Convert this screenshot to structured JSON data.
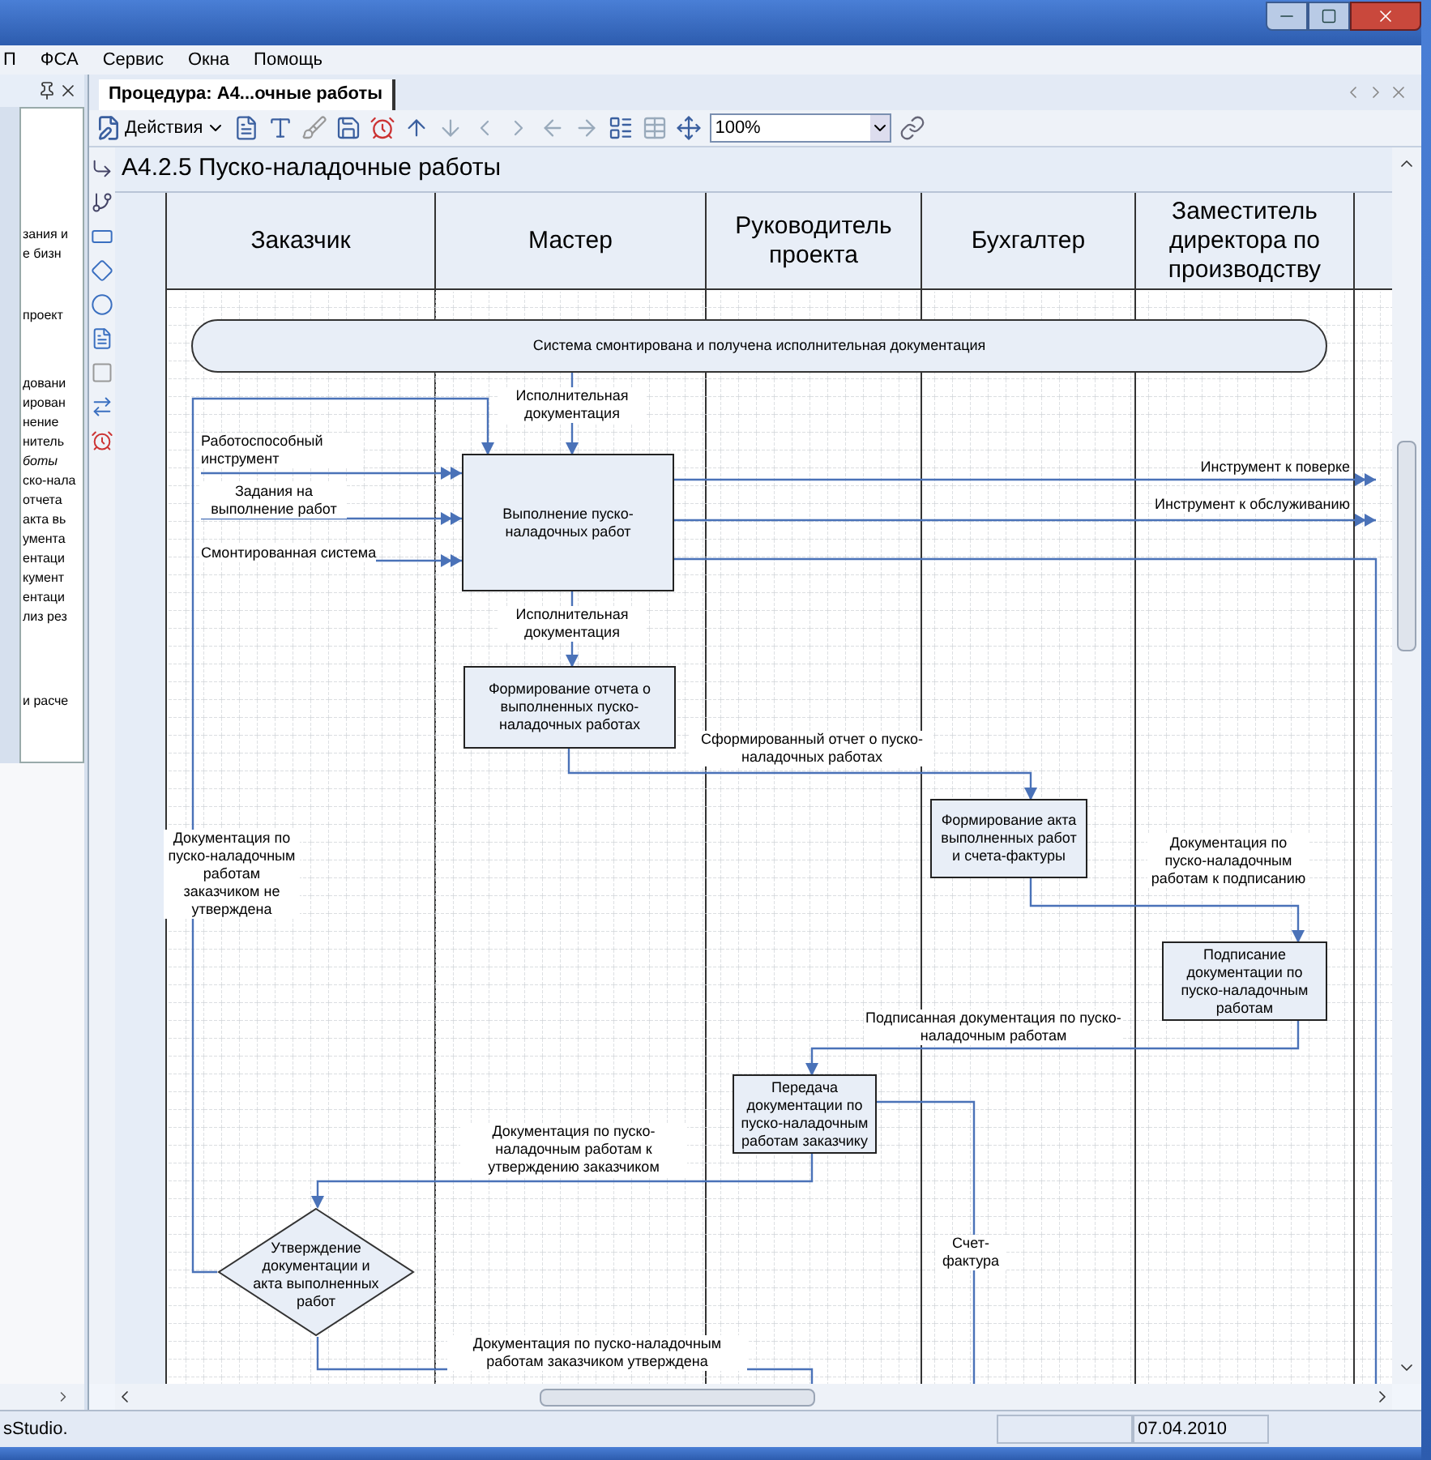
{
  "menu": [
    "П",
    "ФСА",
    "Сервис",
    "Окна",
    "Помощь"
  ],
  "left_panel": {
    "groups": [
      [
        {
          "text": "зания и",
          "italic": false
        },
        {
          "text": "е бизн",
          "italic": false
        }
      ],
      [
        {
          "text": "проект",
          "italic": false
        }
      ],
      [
        {
          "text": "довани",
          "italic": false
        },
        {
          "text": "ирован",
          "italic": false
        },
        {
          "text": "нение",
          "italic": false
        },
        {
          "text": "нитель",
          "italic": false
        },
        {
          "text": "боты",
          "italic": true
        },
        {
          "text": "ско-нала",
          "italic": false
        },
        {
          "text": "отчета",
          "italic": false
        },
        {
          "text": "акта вь",
          "italic": false
        },
        {
          "text": "умента",
          "italic": false
        },
        {
          "text": "ентаци",
          "italic": false
        },
        {
          "text": "кумент",
          "italic": false
        },
        {
          "text": "ентаци",
          "italic": false
        },
        {
          "text": "лиз рез",
          "italic": false
        }
      ],
      [
        {
          "text": "и расче",
          "italic": false
        }
      ]
    ]
  },
  "document_tab": {
    "label": "Процедура: А4...очные работы"
  },
  "toolbar": {
    "actions_button": "Действия",
    "zoom": "100%"
  },
  "diagram": {
    "title": "А4.2.5 Пуско-наладочные работы",
    "lanes": [
      "Заказчик",
      "Мастер",
      "Руководитель проекта",
      "Бухгалтер",
      "Заместитель директора по производству"
    ],
    "nodes": [
      {
        "kind": "event",
        "text": "Система смонтирована и получена исполнительная документация"
      },
      {
        "kind": "process",
        "text": "Выполнение пуско-наладочных работ"
      },
      {
        "kind": "process",
        "text": "Формирование отчета о выполненных пуско-наладочных работах"
      },
      {
        "kind": "process",
        "text": "Формирование акта выполненных работ и счета-фактуры"
      },
      {
        "kind": "process",
        "text": "Подписание документации по пуско-наладочным работам"
      },
      {
        "kind": "process",
        "text": "Передача документации по пуско-наладочным работам заказчику"
      },
      {
        "kind": "decision",
        "text": "Утверждение документации и акта выполненных работ"
      }
    ],
    "labels": [
      "Исполнительная документация",
      "Работоспособный инструмент",
      "Задания на выполнение работ",
      "Смонтированная система",
      "Инструмент к поверке",
      "Инструмент к обслуживанию",
      "Исполнительная документация",
      "Сформированный отчет о пуско-наладочных работах",
      "Документация по пуско-наладочным работам заказчиком не утверждена",
      "Документация по пуско-наладочным работам к подписанию",
      "Подписанная документация по пуско-наладочным работам",
      "Документация по пуско-наладочным работам к утверждению заказчиком",
      "Счет-фактура",
      "Документация по пуско-наладочным работам заказчиком утверждена"
    ]
  },
  "status_bar": {
    "left": "sStudio.",
    "date": "07.04.2010"
  }
}
